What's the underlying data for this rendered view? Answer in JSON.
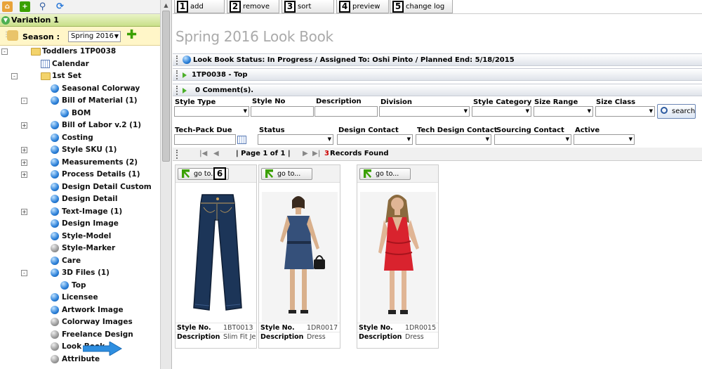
{
  "sidebar": {
    "variation_label": "Variation 1",
    "season_label": "Season :",
    "season_value": "Spring 2016",
    "tree": [
      {
        "label": "Toddlers   1TP0038",
        "icon": "folder-icon",
        "depth": 0,
        "expander": "-"
      },
      {
        "label": "Calendar",
        "icon": "calendar-icon",
        "depth": 1
      },
      {
        "label": "1st Set",
        "icon": "folder-icon",
        "depth": 1,
        "expander": "-"
      },
      {
        "label": "Seasonal Colorway",
        "icon": "blue-ball-icon",
        "depth": 2
      },
      {
        "label": "Bill of Material (1)",
        "icon": "blue-ball-icon",
        "depth": 2,
        "expander": "-"
      },
      {
        "label": "BOM",
        "icon": "blue-ball-icon",
        "depth": 3
      },
      {
        "label": "Bill of Labor v.2 (1)",
        "icon": "blue-ball-icon",
        "depth": 2,
        "expander": "+"
      },
      {
        "label": "Costing",
        "icon": "blue-ball-icon",
        "depth": 2
      },
      {
        "label": "Style SKU (1)",
        "icon": "blue-ball-icon",
        "depth": 2,
        "expander": "+"
      },
      {
        "label": "Measurements (2)",
        "icon": "blue-ball-icon",
        "depth": 2,
        "expander": "+"
      },
      {
        "label": "Process Details (1)",
        "icon": "blue-ball-icon",
        "depth": 2,
        "expander": "+"
      },
      {
        "label": "Design Detail Custom",
        "icon": "blue-ball-icon",
        "depth": 2
      },
      {
        "label": "Design Detail",
        "icon": "blue-ball-icon",
        "depth": 2
      },
      {
        "label": "Text-Image (1)",
        "icon": "blue-ball-icon",
        "depth": 2,
        "expander": "+"
      },
      {
        "label": "Design Image",
        "icon": "blue-ball-icon",
        "depth": 2
      },
      {
        "label": "Style-Model",
        "icon": "blue-ball-icon",
        "depth": 2
      },
      {
        "label": "Style-Marker",
        "icon": "grey-ball-icon",
        "depth": 2
      },
      {
        "label": "Care",
        "icon": "blue-ball-icon",
        "depth": 2
      },
      {
        "label": "3D Files (1)",
        "icon": "blue-ball-icon",
        "depth": 2,
        "expander": "-"
      },
      {
        "label": "Top",
        "icon": "blue-ball-icon",
        "depth": 3
      },
      {
        "label": "Licensee",
        "icon": "blue-ball-icon",
        "depth": 2
      },
      {
        "label": "Artwork Image",
        "icon": "blue-ball-icon",
        "depth": 2
      },
      {
        "label": "Colorway Images",
        "icon": "grey-ball-icon",
        "depth": 2
      },
      {
        "label": "Freelance Design",
        "icon": "grey-ball-icon",
        "depth": 2
      },
      {
        "label": "Look Book",
        "icon": "grey-ball-icon",
        "depth": 2
      },
      {
        "label": "Attribute",
        "icon": "grey-ball-icon",
        "depth": 2
      }
    ]
  },
  "actions": [
    {
      "num": "1",
      "label": "add"
    },
    {
      "num": "2",
      "label": "remove"
    },
    {
      "num": "3",
      "label": "sort"
    },
    {
      "num": "4",
      "label": "preview"
    },
    {
      "num": "5",
      "label": "change log"
    }
  ],
  "page_title": "Spring 2016 Look Book",
  "status_bar": "Look Book  Status: In Progress / Assigned To: Oshi Pinto / Planned End: 5/18/2015",
  "style_bar": "1TP0038 - Top",
  "comments_bar": "0 Comment(s).",
  "filters": {
    "style_type": "Style Type",
    "style_no": "Style No",
    "description": "Description",
    "division": "Division",
    "style_category": "Style Category",
    "size_range": "Size Range",
    "size_class": "Size Class",
    "search": "search",
    "tech_pack_due": "Tech-Pack Due",
    "status": "Status",
    "design_contact": "Design Contact",
    "tech_design_contact": "Tech Design Contact",
    "sourcing_contact": "Sourcing Contact",
    "active": "Active"
  },
  "pager": {
    "page_text": "| Page 1 of 1 |",
    "count": "3",
    "records_text": " Records Found"
  },
  "cards": [
    {
      "go_label": "go to...",
      "style_no_label": "Style No.",
      "style_no": "1BT0013",
      "desc_label": "Description",
      "desc": "Slim Fit Jean"
    },
    {
      "go_label": "go to...",
      "style_no_label": "Style No.",
      "style_no": "1DR0017",
      "desc_label": "Description",
      "desc": "Dress"
    },
    {
      "go_label": "go to...",
      "style_no_label": "Style No.",
      "style_no": "1DR0015",
      "desc_label": "Description",
      "desc": "Dress"
    }
  ],
  "step6": "6",
  "colors": {
    "accent_green": "#c9e08a",
    "season_bg": "#fff6c8",
    "title_grey": "#aaaaaa",
    "count_red": "#cc0000"
  }
}
